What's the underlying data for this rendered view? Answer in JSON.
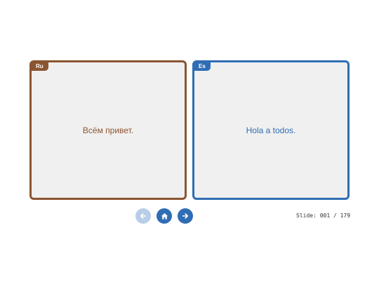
{
  "cards": {
    "source": {
      "lang_tag": "Ru",
      "text": "Всём привет.",
      "color": "#8b5530"
    },
    "target": {
      "lang_tag": "Es",
      "text": "Hola a todos.",
      "color": "#2f6db5"
    }
  },
  "navigation": {
    "prev": {
      "icon": "arrow-left-icon",
      "state": "disabled",
      "color": "#b9cde6"
    },
    "home": {
      "icon": "home-icon",
      "color": "#2f6db5"
    },
    "next": {
      "icon": "arrow-right-icon",
      "color": "#2f6db5"
    }
  },
  "status": {
    "slide_label": "Slide: 001 / 179"
  }
}
